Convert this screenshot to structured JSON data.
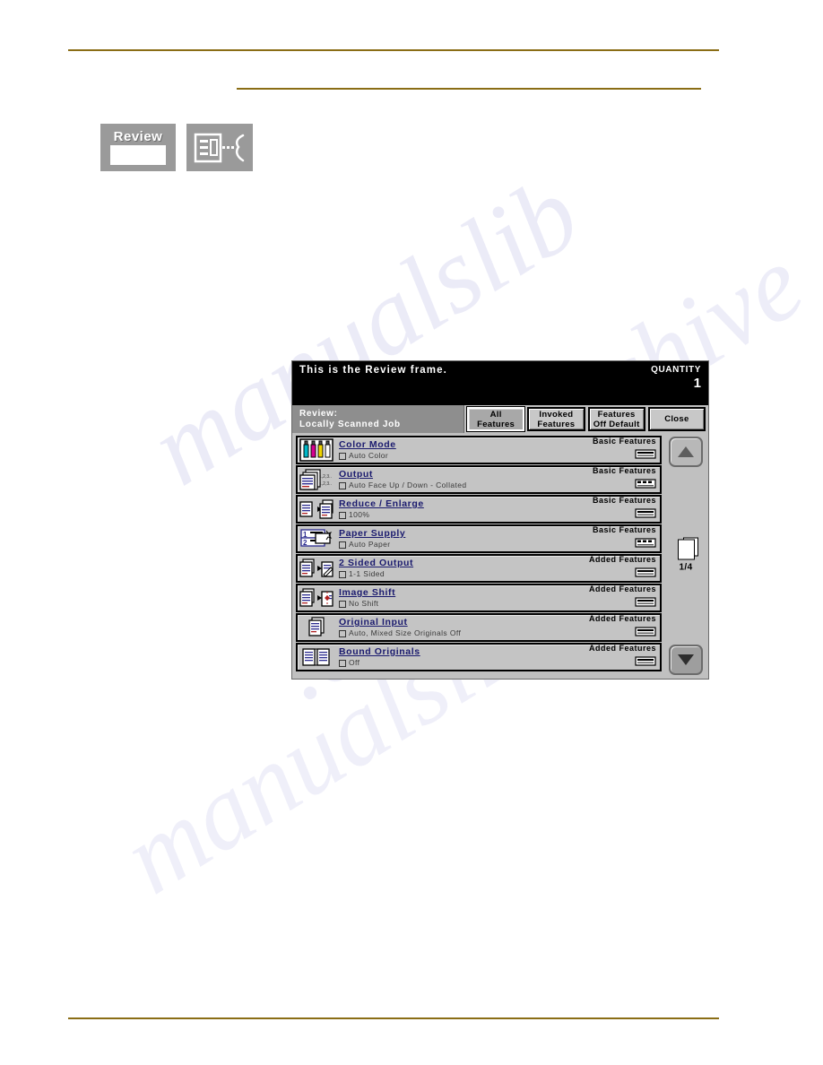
{
  "watermark": {
    "fragments": [
      "manualslib",
      ".com",
      "archive",
      "manualslib"
    ]
  },
  "tiles": {
    "review_tile": {
      "label": "Review",
      "icon": "review-button-icon"
    },
    "panel_tile": {
      "icon": "screen-to-operator-icon"
    }
  },
  "screen": {
    "header": {
      "message": "This is the Review frame.",
      "quantity_label": "QUANTITY",
      "quantity_value": "1"
    },
    "title_panel": {
      "line1": "Review:",
      "line2": "Locally Scanned Job"
    },
    "tabs": [
      {
        "line1": "All",
        "line2": "Features",
        "selected": true
      },
      {
        "line1": "Invoked",
        "line2": "Features",
        "selected": false
      },
      {
        "line1": "Features",
        "line2": "Off Default",
        "selected": false
      },
      {
        "line1": "Close",
        "line2": "",
        "selected": false
      }
    ],
    "features": [
      {
        "title": "Color Mode",
        "value": "Auto Color",
        "category": "Basic Features",
        "icon": "ink-bottles-icon"
      },
      {
        "title": "Output",
        "value": "Auto Face Up / Down - Collated",
        "category": "Basic Features",
        "icon": "output-stack-icon"
      },
      {
        "title": "Reduce / Enlarge",
        "value": "100%",
        "category": "Basic Features",
        "icon": "reduce-enlarge-icon"
      },
      {
        "title": "Paper Supply",
        "value": "Auto Paper",
        "category": "Basic Features",
        "icon": "paper-tray-icon"
      },
      {
        "title": "2 Sided Output",
        "value": "1-1 Sided",
        "category": "Added Features",
        "icon": "two-sided-icon"
      },
      {
        "title": "Image Shift",
        "value": "No Shift",
        "category": "Added Features",
        "icon": "image-shift-icon"
      },
      {
        "title": "Original Input",
        "value": "Auto, Mixed Size Originals Off",
        "category": "Added Features",
        "icon": "original-input-icon"
      },
      {
        "title": "Bound Originals",
        "value": "Off",
        "category": "Added Features",
        "icon": "bound-originals-icon"
      }
    ],
    "scroll": {
      "up_label": "scroll-up",
      "down_label": "scroll-down",
      "page_indicator": "1/4"
    }
  },
  "colors": {
    "rule": "#8a6d15",
    "screen_bg": "#c0c0c0",
    "header_bg": "#000000",
    "title_bg": "#8e8e8e",
    "row_bg": "#c4c4c4",
    "title_text": "#1a1a6e",
    "cyan": "#00b7c8",
    "magenta": "#d6008f",
    "yellow": "#f0d400"
  }
}
